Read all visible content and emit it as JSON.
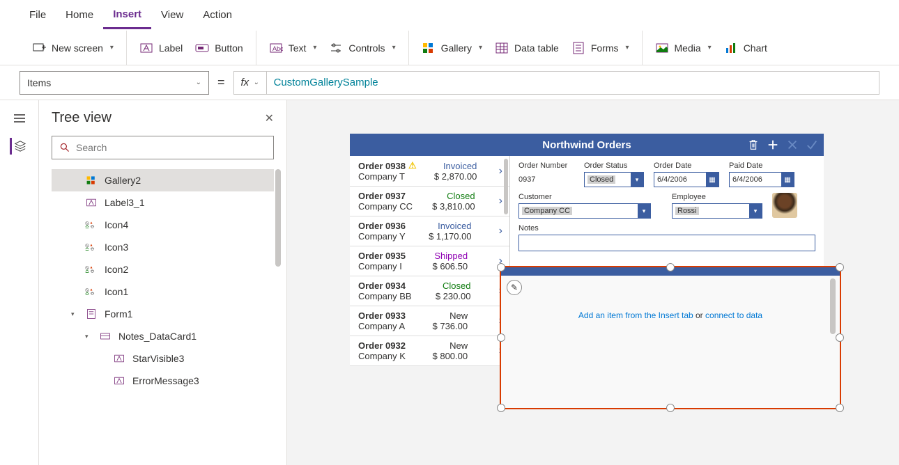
{
  "menu": {
    "file": "File",
    "home": "Home",
    "insert": "Insert",
    "view": "View",
    "action": "Action"
  },
  "ribbon": {
    "newscreen": "New screen",
    "label": "Label",
    "button": "Button",
    "text": "Text",
    "controls": "Controls",
    "gallery": "Gallery",
    "datatable": "Data table",
    "forms": "Forms",
    "media": "Media",
    "chart": "Chart"
  },
  "formula": {
    "property": "Items",
    "value": "CustomGallerySample"
  },
  "tree": {
    "title": "Tree view",
    "search_placeholder": "Search",
    "items": [
      {
        "label": "Gallery2",
        "icon": "gallery",
        "indent": 1,
        "selected": true
      },
      {
        "label": "Label3_1",
        "icon": "label",
        "indent": 1
      },
      {
        "label": "Icon4",
        "icon": "iconset",
        "indent": 1
      },
      {
        "label": "Icon3",
        "icon": "iconset",
        "indent": 1
      },
      {
        "label": "Icon2",
        "icon": "iconset",
        "indent": 1
      },
      {
        "label": "Icon1",
        "icon": "iconset",
        "indent": 1
      },
      {
        "label": "Form1",
        "icon": "form",
        "indent": 1,
        "expander": "▾"
      },
      {
        "label": "Notes_DataCard1",
        "icon": "card",
        "indent": 2,
        "expander": "▾"
      },
      {
        "label": "StarVisible3",
        "icon": "label",
        "indent": 3
      },
      {
        "label": "ErrorMessage3",
        "icon": "label",
        "indent": 3
      }
    ]
  },
  "app": {
    "title": "Northwind Orders",
    "orders": [
      {
        "num": "Order 0938",
        "company": "Company T",
        "status": "Invoiced",
        "statusClass": "st-invoiced",
        "amount": "$ 2,870.00",
        "warn": true
      },
      {
        "num": "Order 0937",
        "company": "Company CC",
        "status": "Closed",
        "statusClass": "st-closed",
        "amount": "$ 3,810.00"
      },
      {
        "num": "Order 0936",
        "company": "Company Y",
        "status": "Invoiced",
        "statusClass": "st-invoiced",
        "amount": "$ 1,170.00"
      },
      {
        "num": "Order 0935",
        "company": "Company I",
        "status": "Shipped",
        "statusClass": "st-shipped",
        "amount": "$ 606.50"
      },
      {
        "num": "Order 0934",
        "company": "Company BB",
        "status": "Closed",
        "statusClass": "st-closed",
        "amount": "$ 230.00"
      },
      {
        "num": "Order 0933",
        "company": "Company A",
        "status": "New",
        "statusClass": "st-new",
        "amount": "$ 736.00"
      },
      {
        "num": "Order 0932",
        "company": "Company K",
        "status": "New",
        "statusClass": "st-new",
        "amount": "$ 800.00"
      }
    ],
    "detail": {
      "ordernum_label": "Order Number",
      "ordernum": "0937",
      "status_label": "Order Status",
      "status": "Closed",
      "orderdate_label": "Order Date",
      "orderdate": "6/4/2006",
      "paiddate_label": "Paid Date",
      "paiddate": "6/4/2006",
      "customer_label": "Customer",
      "customer": "Company CC",
      "employee_label": "Employee",
      "employee": "Rossi",
      "notes_label": "Notes"
    },
    "gallery_msg": {
      "a1": "Add an item from the Insert tab",
      "sep": " or ",
      "a2": "connect to data"
    }
  }
}
